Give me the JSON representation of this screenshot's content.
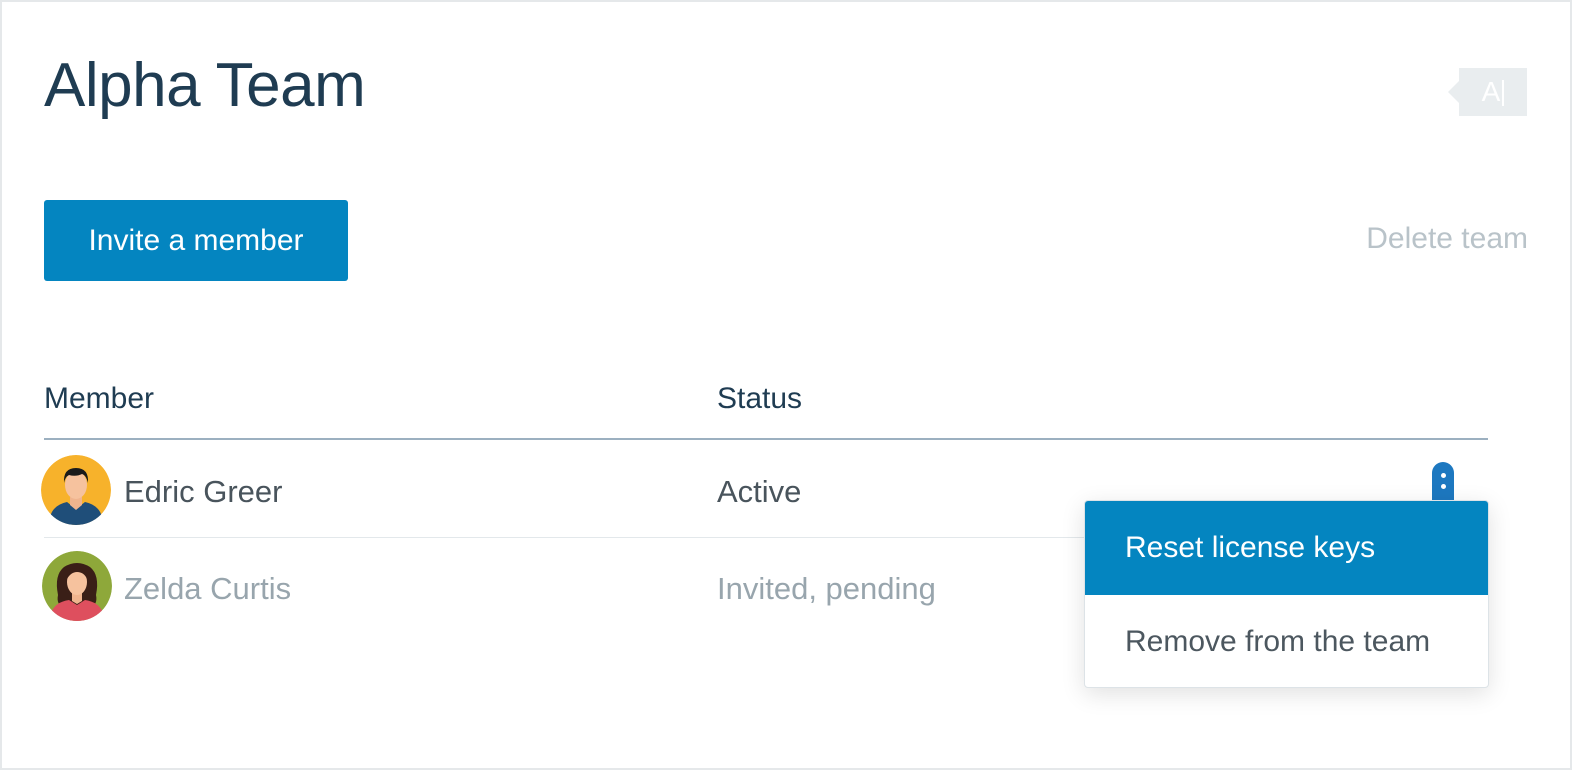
{
  "team": {
    "title": "Alpha Team"
  },
  "lang_badge": {
    "letter": "A"
  },
  "actions": {
    "invite_label": "Invite a member",
    "delete_label": "Delete team"
  },
  "table": {
    "headers": {
      "member": "Member",
      "status": "Status"
    },
    "rows": [
      {
        "name": "Edric Greer",
        "status": "Active",
        "avatar_bg": "#f7b22b"
      },
      {
        "name": "Zelda Curtis",
        "status": "Invited, pending",
        "avatar_bg": "#8ea83a"
      }
    ]
  },
  "context_menu": {
    "items": [
      {
        "label": "Reset license keys",
        "highlighted": true
      },
      {
        "label": "Remove from the team",
        "highlighted": false
      }
    ]
  },
  "colors": {
    "primary": "#0485c0",
    "title": "#1f3c52",
    "muted": "#98a5ad"
  }
}
